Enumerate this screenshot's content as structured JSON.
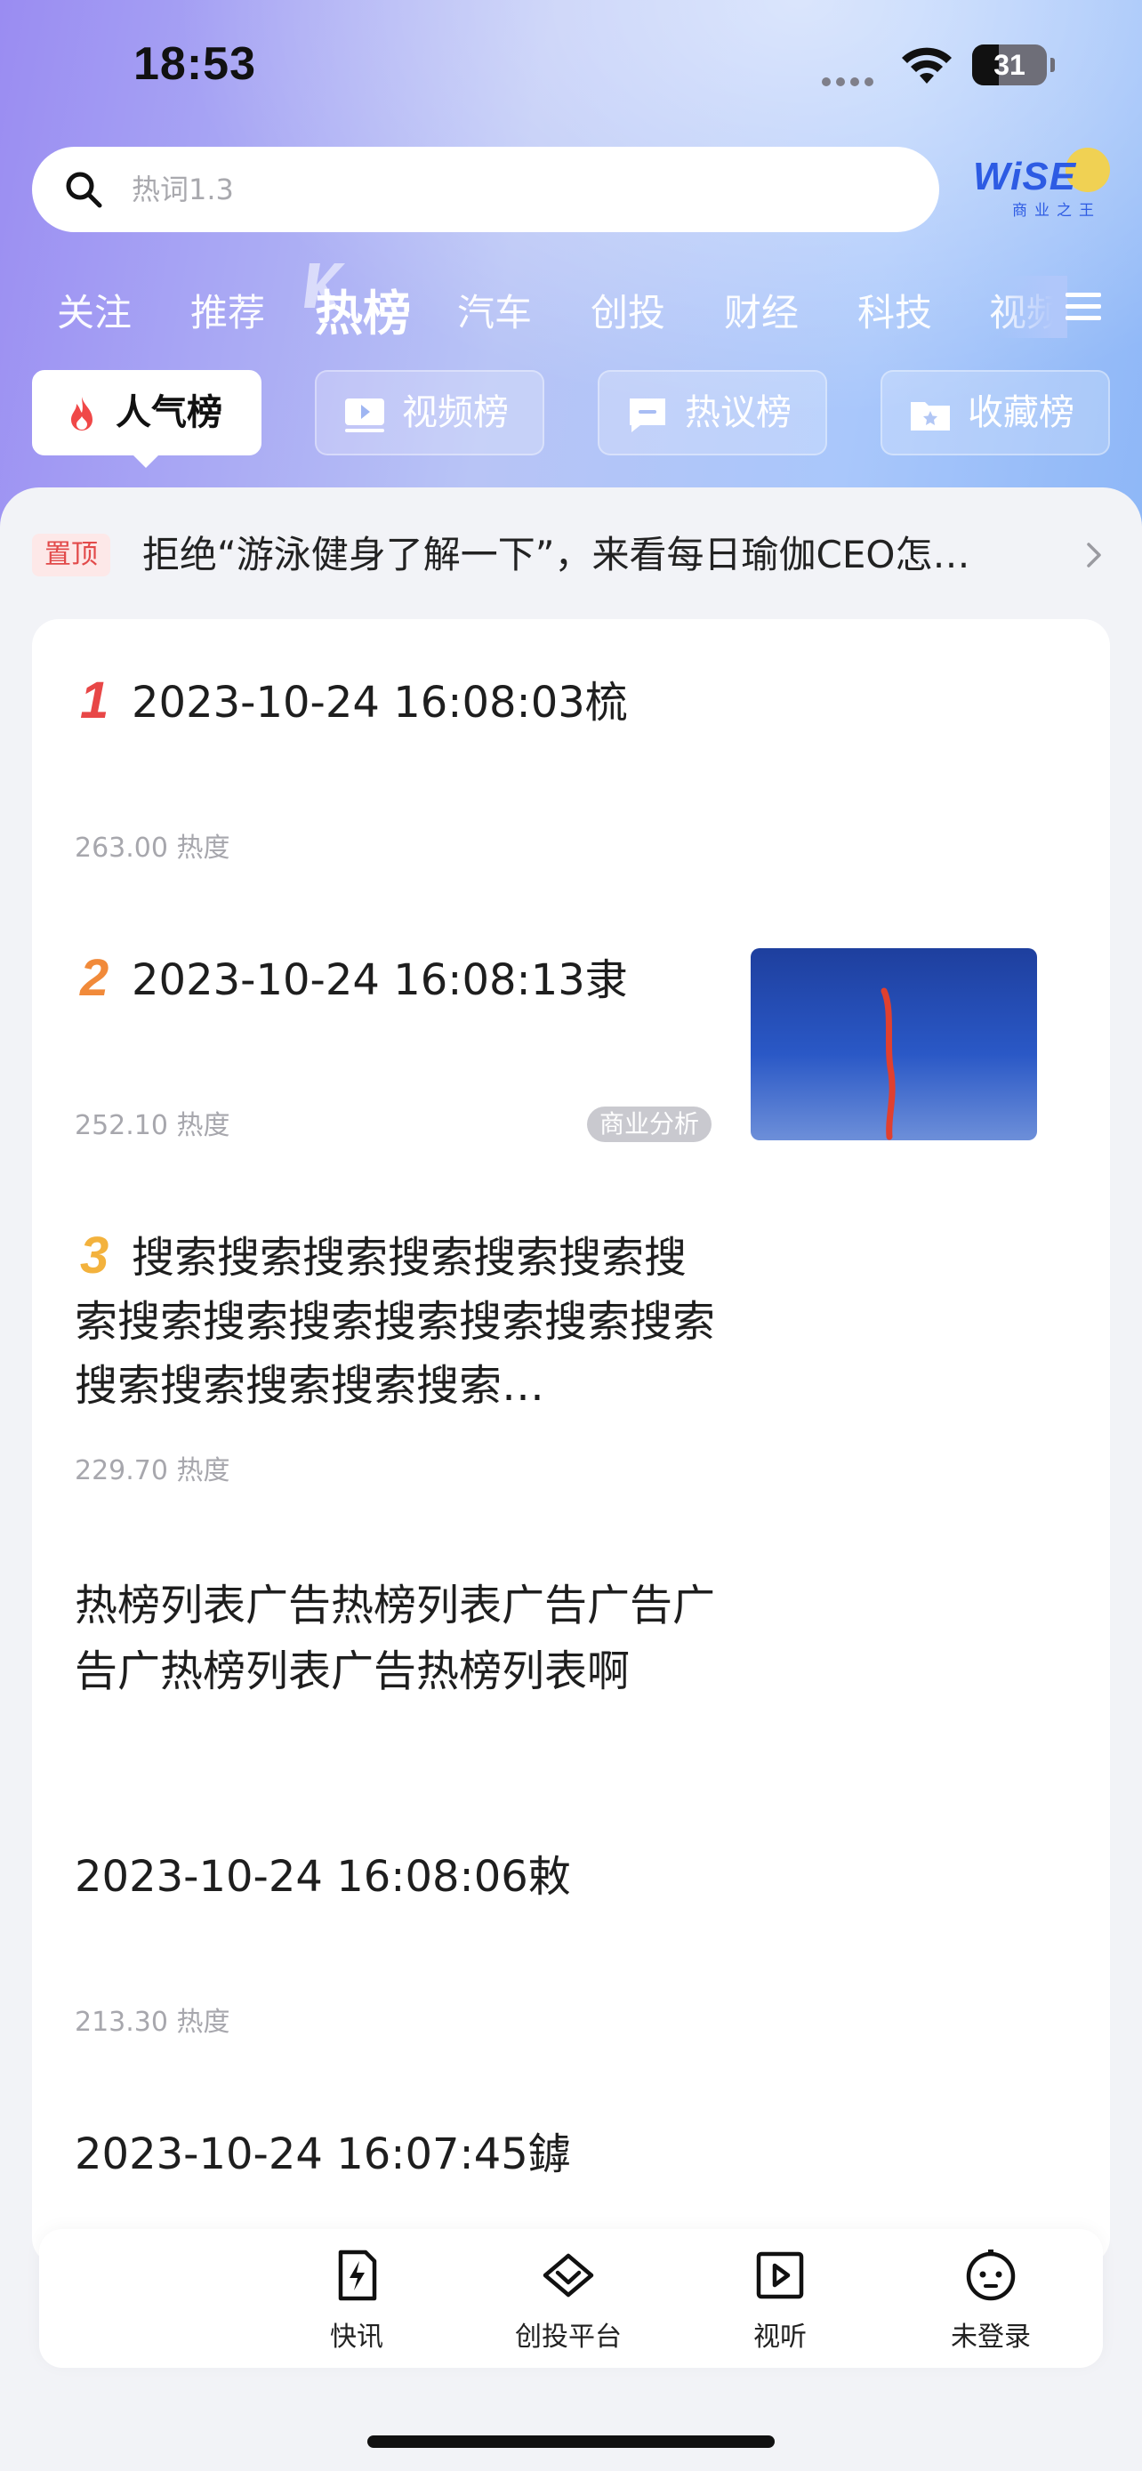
{
  "status_bar": {
    "time": "18:53",
    "battery": "31"
  },
  "search": {
    "placeholder": "热词1.3"
  },
  "brand": {
    "name": "WiSE",
    "tagline": "商业之王"
  },
  "channels": [
    {
      "label": "关注",
      "active": false
    },
    {
      "label": "推荐",
      "active": false
    },
    {
      "label": "热榜",
      "active": true
    },
    {
      "label": "汽车",
      "active": false
    },
    {
      "label": "创投",
      "active": false
    },
    {
      "label": "财经",
      "active": false
    },
    {
      "label": "科技",
      "active": false
    },
    {
      "label": "视频",
      "active": false
    }
  ],
  "rank_tabs": [
    {
      "label": "人气榜",
      "icon": "flame-icon",
      "active": true
    },
    {
      "label": "视频榜",
      "icon": "video-icon",
      "active": false
    },
    {
      "label": "热议榜",
      "icon": "comment-icon",
      "active": false
    },
    {
      "label": "收藏榜",
      "icon": "folder-star-icon",
      "active": false
    }
  ],
  "pinned": {
    "badge": "置顶",
    "text": "拒绝“游泳健身了解一下”，来看每日瑜伽CEO怎…"
  },
  "hot_list": [
    {
      "rank": "1",
      "title": "2023-10-24 16:08:03梳",
      "meta": "263.00 热度"
    },
    {
      "rank": "2",
      "title": "2023-10-24 16:08:13隶",
      "meta": "252.10 热度"
    },
    {
      "rank": "3",
      "title": "搜索搜索搜索搜索搜索搜索搜索搜索搜索搜索搜索搜索搜索搜索搜索搜索搜索搜索搜索…",
      "meta": "229.70 热度"
    }
  ],
  "ad": {
    "title": "热榜列表广告热榜列表广告广告广告广热榜列表广告热榜列表啊",
    "tag": "商业分析"
  },
  "hot_list_more": [
    {
      "title": "2023-10-24 16:08:06敕",
      "meta": "213.30 热度"
    },
    {
      "title": "2023-10-24 16:07:45鏬"
    }
  ],
  "rank_colors": {
    "1": "#e84747",
    "2": "#f18a3a",
    "3": "#f3b23d"
  },
  "bottom_nav": [
    {
      "label": "快讯",
      "icon": "flash-news-icon"
    },
    {
      "label": "创投平台",
      "icon": "diamond-icon"
    },
    {
      "label": "视听",
      "icon": "play-icon"
    },
    {
      "label": "未登录",
      "icon": "user-icon"
    }
  ]
}
